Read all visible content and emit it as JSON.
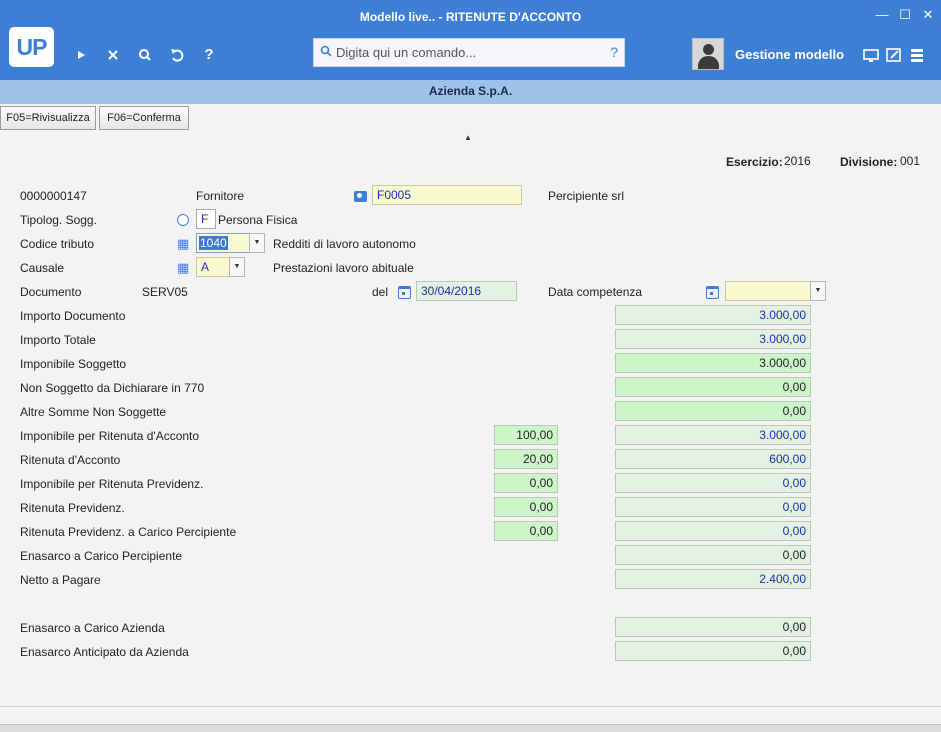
{
  "window": {
    "title": "Modello live.. - RITENUTE D'ACCONTO",
    "controls": [
      "—",
      "☐",
      "✕"
    ]
  },
  "toolbar": {
    "logo_text": "UP",
    "command_placeholder": "Digita qui un comando...",
    "command_help": "?",
    "help_label": "?",
    "user_label": "Gestione modello"
  },
  "company": "Azienda S.p.A.",
  "fkeys": {
    "f05": "F05=Rivisualizza",
    "f06": "F06=Conferma"
  },
  "header": {
    "esercizio_label": "Esercizio:",
    "esercizio_value": "2016",
    "divisione_label": "Divisione:",
    "divisione_value": "001"
  },
  "form": {
    "record_number": "0000000147",
    "fornitore_label": "Fornitore",
    "fornitore_code": "F0005",
    "fornitore_name": "Percipiente srl",
    "tipolog_label": "Tipolog. Sogg.",
    "tipolog_code": "F",
    "tipolog_desc": "Persona Fisica",
    "codice_label": "Codice tributo",
    "codice_value": "1040",
    "codice_desc": "Redditi di lavoro autonomo",
    "causale_label": "Causale",
    "causale_value": "A",
    "causale_desc": "Prestazioni lavoro abituale",
    "documento_label": "Documento",
    "documento_value": "SERV05",
    "del_label": "del",
    "del_value": "30/04/2016",
    "competenza_label": "Data competenza",
    "competenza_value": ""
  },
  "amounts": {
    "importo_documento": {
      "label": "Importo Documento",
      "value": "3.000,00"
    },
    "importo_totale": {
      "label": "Importo Totale",
      "value": "3.000,00"
    },
    "imponibile_soggetto": {
      "label": "Imponibile Soggetto",
      "value": "3.000,00"
    },
    "non_soggetto_770": {
      "label": "Non Soggetto da Dichiarare in 770",
      "value": "0,00"
    },
    "altre_somme": {
      "label": "Altre Somme Non Soggette",
      "value": "0,00"
    },
    "imponibile_ritenuta": {
      "label": "Imponibile per Ritenuta d'Acconto",
      "pct": "100,00",
      "value": "3.000,00"
    },
    "ritenuta_acconto": {
      "label": "Ritenuta d'Acconto",
      "pct": "20,00",
      "value": "600,00"
    },
    "imponibile_previdenz": {
      "label": "Imponibile per Ritenuta Previdenz.",
      "pct": "0,00",
      "value": "0,00"
    },
    "ritenuta_previdenz": {
      "label": "Ritenuta Previdenz.",
      "pct": "0,00",
      "value": "0,00"
    },
    "ritenuta_previdenz_percip": {
      "label": "Ritenuta Previdenz. a Carico Percipiente",
      "pct": "0,00",
      "value": "0,00"
    },
    "enasarco_percipiente": {
      "label": "Enasarco a Carico Percipiente",
      "value": "0,00"
    },
    "netto_pagare": {
      "label": "Netto a Pagare",
      "value": "2.400,00"
    },
    "enasarco_azienda": {
      "label": "Enasarco a Carico Azienda",
      "value": "0,00"
    },
    "enasarco_anticipato": {
      "label": "Enasarco Anticipato da Azienda",
      "value": "0,00"
    }
  }
}
